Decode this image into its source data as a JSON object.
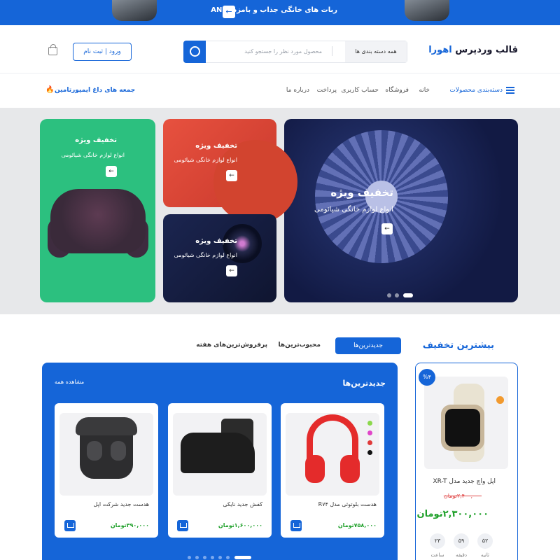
{
  "topbar": {
    "text": "ربات های خانگی جذاب و بامزه ANKI",
    "arrow": "←"
  },
  "header": {
    "logo_prefix": "قالب وردپرس",
    "logo_brand": "اهورا",
    "search_placeholder": "محصول مورد نظر را جستجو کنید",
    "category_select": "همه دسته بندی ها",
    "login_label": "ورود | ثبت نام"
  },
  "nav": {
    "categories": "دسته‌بندی محصولات",
    "items": [
      "خانه",
      "فروشگاه",
      "حساب کاربری",
      "پرداخت",
      "درباره ما"
    ],
    "promo": "جمعه های داغ ایمپورتامین",
    "promo_icon": "🔥"
  },
  "hero": {
    "main": {
      "title": "تخفیف ویژه",
      "subtitle": "انواع لوازم خانگی شیائومی"
    },
    "red": {
      "title": "تخفیف ویژه",
      "subtitle": "انواع لوازم خانگی شیائومی"
    },
    "dark": {
      "title": "تخفیف ویژه",
      "subtitle": "انواع لوازم خانگی شیائومی"
    },
    "green": {
      "title": "تخفیف ویژه",
      "subtitle": "انواع لوازم خانگی شیائومی"
    },
    "arrow": "←"
  },
  "products_section": {
    "title": "بیشترین تخفیف",
    "tabs": [
      "جدیدترین‌ها",
      "محبوب‌ترین‌ها",
      "پرفروش‌ترین‌های هفته"
    ]
  },
  "deal": {
    "badge": "%۴",
    "name": "اپل واچ جدید مدل XR-T",
    "old_price": "۲,۴۰۰,۰۰۰تومان",
    "new_price": "۲,۳۰۰,۰۰۰تومان",
    "countdown": [
      {
        "value": "۵۲",
        "label": "ثانیه"
      },
      {
        "value": "۵۹",
        "label": "دقیقه"
      },
      {
        "value": "۲۳",
        "label": "ساعت"
      }
    ]
  },
  "panel": {
    "title": "جدیدترین‌ها",
    "view_all": "مشاهده همه",
    "products": [
      {
        "name": "هدست بلوتوثی مدل R۷۴",
        "price": "۷۵۸,۰۰۰تومان"
      },
      {
        "name": "کفش جدید نایکی",
        "price": "۱,۶۰۰,۰۰۰تومان"
      },
      {
        "name": "هدست جدید شرکت اپل",
        "price": "۳۹۰,۰۰۰تومان"
      }
    ],
    "swatches": [
      "#8bd84c",
      "#e045c8",
      "#e03a3a",
      "#111111"
    ]
  },
  "colors": {
    "accent": "#1565d8",
    "price": "#1fa02a",
    "sale": "#e04545",
    "green_card": "#2cc07f"
  }
}
